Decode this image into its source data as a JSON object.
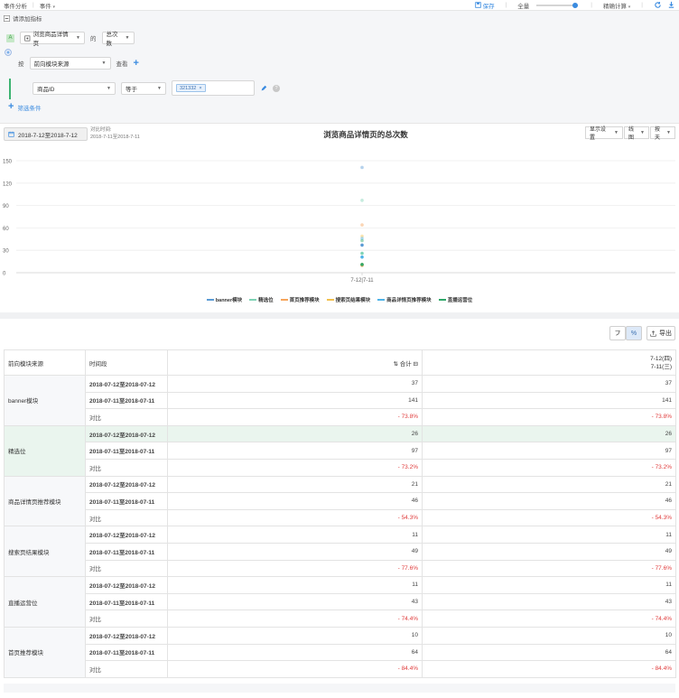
{
  "topbar": {
    "nav_analysis": "事件分析",
    "nav_event": "事件",
    "save_label": "保存",
    "sample_label": "全量",
    "calc_label": "精确计算"
  },
  "panel": {
    "collapse_label": "请添加指标",
    "metric_tag": "A",
    "event_select": "浏览商品详情页",
    "of_label": "的",
    "metric_select": "总次数",
    "by_label": "按",
    "group_select": "前向模块来源",
    "view_label": "查看",
    "filter_field": "商品ID",
    "filter_op": "等于",
    "filter_value": "321332",
    "add_filter_label": "筛选条件"
  },
  "chart_header": {
    "date_range": "2018-7-12至2018-7-12",
    "compare_label": "对比时间:",
    "compare_range": "2018-7-11至2018-7-11",
    "title": "浏览商品详情页的总次数",
    "display_settings": "显示设置",
    "chart_type": "线图",
    "granularity": "按天"
  },
  "chart_data": {
    "type": "scatter",
    "title": "浏览商品详情页的总次数",
    "categories": [
      "7-12|7-11"
    ],
    "ylim": [
      0,
      150
    ],
    "yticks": [
      0,
      30,
      60,
      90,
      120,
      150
    ],
    "grid": true,
    "legend_position": "bottom",
    "series": [
      {
        "name": "banner模块",
        "color": "#5b9bd5",
        "values": [
          37
        ],
        "compare_values": [
          141
        ]
      },
      {
        "name": "精选位",
        "color": "#7fd3b5",
        "values": [
          26
        ],
        "compare_values": [
          97
        ]
      },
      {
        "name": "首页推荐模块",
        "color": "#f6a55c",
        "values": [
          10
        ],
        "compare_values": [
          64
        ]
      },
      {
        "name": "搜索页结果模块",
        "color": "#f2c14e",
        "values": [
          11
        ],
        "compare_values": [
          49
        ]
      },
      {
        "name": "商品详情页推荐模块",
        "color": "#4fb3e8",
        "values": [
          21
        ],
        "compare_values": [
          46
        ]
      },
      {
        "name": "直播运营位",
        "color": "#2fa86a",
        "values": [
          11
        ],
        "compare_values": [
          43
        ]
      }
    ]
  },
  "table": {
    "tool_collapse": "フ",
    "tool_percent": "%",
    "export_label": "导出",
    "col_group": "前向模块来源",
    "col_period": "时间段",
    "col_total": "合计",
    "col_date_line1": "7-12(四)",
    "col_date_line2": "7-11(三)",
    "period_current": "2018-07-12至2018-07-12",
    "period_compare": "2018-07-11至2018-07-11",
    "compare_label": "对比",
    "groups": [
      {
        "name": "banner模块",
        "current": "37",
        "previous": "141",
        "change": "- 73.8%"
      },
      {
        "name": "精选位",
        "current": "26",
        "previous": "97",
        "change": "- 73.2%"
      },
      {
        "name": "商品详情页推荐模块",
        "current": "21",
        "previous": "46",
        "change": "- 54.3%"
      },
      {
        "name": "搜索页结果模块",
        "current": "11",
        "previous": "49",
        "change": "- 77.6%"
      },
      {
        "name": "直播运营位",
        "current": "11",
        "previous": "43",
        "change": "- 74.4%"
      },
      {
        "name": "首页推荐模块",
        "current": "10",
        "previous": "64",
        "change": "- 84.4%"
      }
    ]
  }
}
